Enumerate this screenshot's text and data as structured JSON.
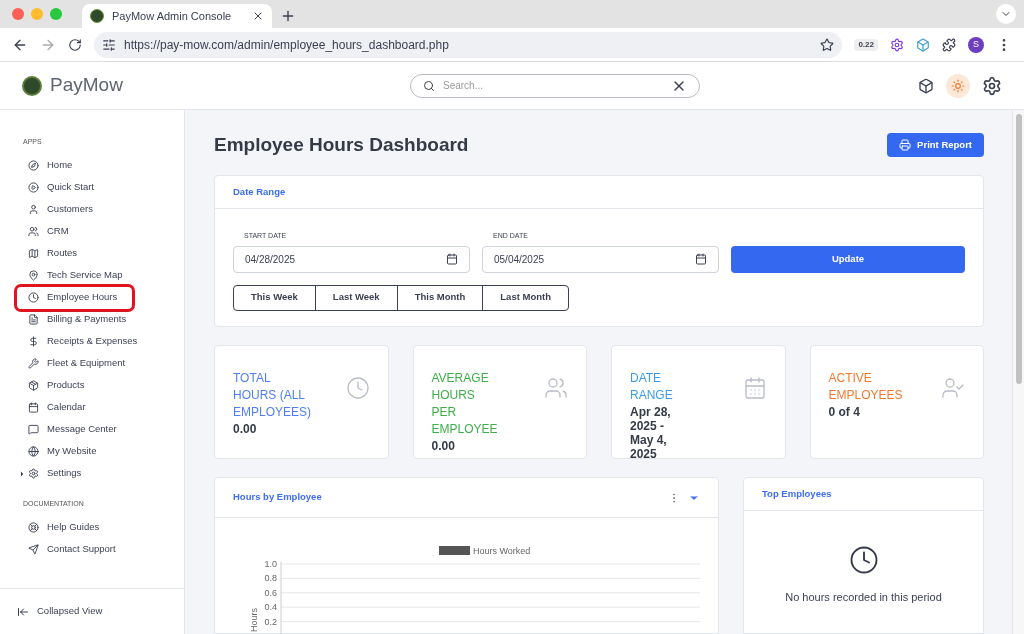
{
  "browser": {
    "tab_title": "PayMow Admin Console",
    "url": "https://pay-mow.com/admin/employee_hours_dashboard.php",
    "extension_badge": "0.22",
    "profile_initial": "S"
  },
  "header": {
    "brand": "PayMow",
    "search": {
      "placeholder": "Search..."
    }
  },
  "sidebar": {
    "sections": [
      {
        "heading": "APPS",
        "items": [
          {
            "label": "Home",
            "kind": "link",
            "selected": false
          },
          {
            "label": "Quick Start",
            "kind": "link",
            "selected": false
          },
          {
            "label": "Customers",
            "kind": "link",
            "selected": false
          },
          {
            "label": "CRM",
            "kind": "link",
            "selected": false
          },
          {
            "label": "Routes",
            "kind": "link",
            "selected": false
          },
          {
            "label": "Tech Service Map",
            "kind": "link",
            "selected": false
          },
          {
            "label": "Employee Hours",
            "kind": "link",
            "selected": true
          },
          {
            "label": "Billing & Payments",
            "kind": "link",
            "selected": false
          },
          {
            "label": "Receipts & Expenses",
            "kind": "link",
            "selected": false
          },
          {
            "label": "Fleet & Equipment",
            "kind": "link",
            "selected": false
          },
          {
            "label": "Products",
            "kind": "link",
            "selected": false
          },
          {
            "label": "Calendar",
            "kind": "link",
            "selected": false
          },
          {
            "label": "Message Center",
            "kind": "link",
            "selected": false
          },
          {
            "label": "My Website",
            "kind": "link",
            "selected": false
          },
          {
            "label": "Settings",
            "kind": "group",
            "selected": false
          }
        ]
      },
      {
        "heading": "DOCUMENTATION",
        "items": [
          {
            "label": "Help Guides",
            "kind": "link",
            "selected": false
          },
          {
            "label": "Contact Support",
            "kind": "link",
            "selected": false
          }
        ]
      }
    ],
    "footer": "Collapsed View"
  },
  "page": {
    "title": "Employee Hours Dashboard",
    "print_button": "Print Report"
  },
  "date_range": {
    "title": "Date Range",
    "start": {
      "label": "START DATE",
      "value": "04/28/2025"
    },
    "end": {
      "label": "END DATE",
      "value": "05/04/2025"
    },
    "update_button": "Update",
    "presets": [
      "This Week",
      "Last Week",
      "This Month",
      "Last Month"
    ]
  },
  "stats": [
    {
      "label": "TOTAL HOURS (ALL EMPLOYEES)",
      "value": "0.00",
      "color": "#4f7df3"
    },
    {
      "label": "AVERAGE HOURS PER EMPLOYEE",
      "value": "0.00",
      "color": "#3fae49"
    },
    {
      "label": "DATE RANGE",
      "value": "Apr 28, 2025 - May 4, 2025",
      "color": "#3d9be9"
    },
    {
      "label": "ACTIVE EMPLOYEES",
      "value": "0 of 4",
      "color": "#f0782f"
    }
  ],
  "hours_chart": {
    "title": "Hours by Employee",
    "chart_data": {
      "type": "bar",
      "ylabel": "Hours",
      "ylim": [
        0,
        1
      ],
      "yticks": [
        {
          "value": 0.2,
          "label": "0.2"
        },
        {
          "value": 0.4,
          "label": "0.4"
        },
        {
          "value": 0.6,
          "label": "0.6"
        },
        {
          "value": 0.8,
          "label": "0.8"
        },
        {
          "value": 1,
          "label": "1.0"
        }
      ],
      "grid": true,
      "series": [
        {
          "name": "Hours Worked",
          "color": "#555555"
        }
      ]
    }
  },
  "top_employees": {
    "title": "Top Employees",
    "empty_message": "No hours recorded in this period"
  }
}
